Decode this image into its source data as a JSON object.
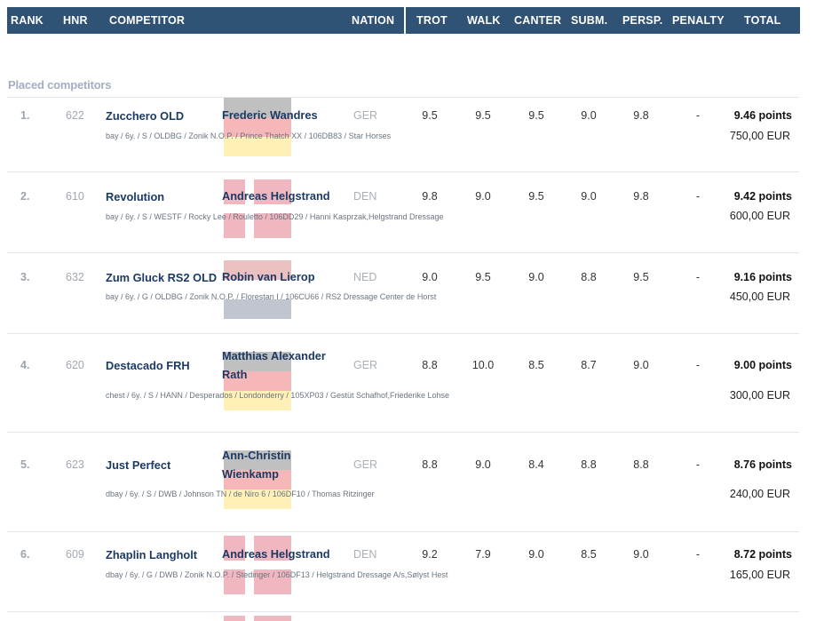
{
  "header": {
    "rank": "RANK",
    "hnr": "HNR",
    "competitor": "COMPETITOR",
    "nation": "NATION",
    "trot": "TROT",
    "walk": "WALK",
    "canter": "CANTER",
    "subm": "SUBM.",
    "persp": "PERSP.",
    "penalty": "PENALTY",
    "total": "TOTAL"
  },
  "section_title": "Placed competitors",
  "rows": [
    {
      "rank": "1.",
      "hnr": "622",
      "horse": "Zucchero OLD",
      "rider": "Frederic Wandres",
      "nation": "GER",
      "flag": "ger",
      "trot": "9.5",
      "walk": "9.5",
      "canter": "9.5",
      "subm": "9.0",
      "persp": "9.8",
      "penalty": "-",
      "points": "9.46 points",
      "prize": "750,00 EUR",
      "details": "bay / 6y. / S / OLDBG / Zonik N.O.P. / Prince Thatch XX / 106DB83 / Star Horses"
    },
    {
      "rank": "2.",
      "hnr": "610",
      "horse": "Revolution",
      "rider": "Andreas Helgstrand",
      "nation": "DEN",
      "flag": "den",
      "trot": "9.8",
      "walk": "9.0",
      "canter": "9.5",
      "subm": "9.0",
      "persp": "9.8",
      "penalty": "-",
      "points": "9.42 points",
      "prize": "600,00 EUR",
      "details": "bay / 6y. / S / WESTF / Rocky Lee / Rouletto / 106DD29 / Hanni Kasprzak,Helgstrand Dressage"
    },
    {
      "rank": "3.",
      "hnr": "632",
      "horse": "Zum Gluck RS2 OLD",
      "rider": "Robin van Lierop",
      "nation": "NED",
      "flag": "ned",
      "trot": "9.0",
      "walk": "9.5",
      "canter": "9.0",
      "subm": "8.8",
      "persp": "9.5",
      "penalty": "-",
      "points": "9.16 points",
      "prize": "450,00 EUR",
      "details": "bay / 6y. / G / OLDBG / Zonik N.O.P. / Florestan I / 106CU66 / RS2 Dressage Center de Horst"
    },
    {
      "rank": "4.",
      "hnr": "620",
      "horse": "Destacado FRH",
      "rider": "Matthias Alexander Rath",
      "rider_l1": "Matthias Alexander",
      "rider_l2": "Rath",
      "nation": "GER",
      "flag": "ger",
      "trot": "8.8",
      "walk": "10.0",
      "canter": "8.5",
      "subm": "8.7",
      "persp": "9.0",
      "penalty": "-",
      "points": "9.00 points",
      "prize": "300,00 EUR",
      "details": "chest / 6y. / S / HANN / Desperados / Londonderry / 105XP03 / Gestüt Schafhof,Friederike Lohse"
    },
    {
      "rank": "5.",
      "hnr": "623",
      "horse": "Just Perfect",
      "rider": "Ann-Christin Wienkamp",
      "rider_l1": "Ann-Christin",
      "rider_l2": "Wienkamp",
      "nation": "GER",
      "flag": "ger",
      "trot": "8.8",
      "walk": "9.0",
      "canter": "8.4",
      "subm": "8.8",
      "persp": "8.8",
      "penalty": "-",
      "points": "8.76 points",
      "prize": "240,00 EUR",
      "details": "dbay / 6y. / S / DWB / Johnson TN / de Niro 6 / 106DF10 / Thomas Ritzinger"
    },
    {
      "rank": "6.",
      "hnr": "609",
      "horse": "Zhaplin Langholt",
      "rider": "Andreas Helgstrand",
      "nation": "DEN",
      "flag": "den",
      "trot": "9.2",
      "walk": "7.9",
      "canter": "9.0",
      "subm": "8.5",
      "persp": "9.0",
      "penalty": "-",
      "points": "8.72 points",
      "prize": "165,00 EUR",
      "details": "dbay / 6y. / G / DWB / Zonik N.O.P. / Stedinger / 106DF13 / Helgstrand Dressage A/s,Sølyst Hest"
    }
  ]
}
